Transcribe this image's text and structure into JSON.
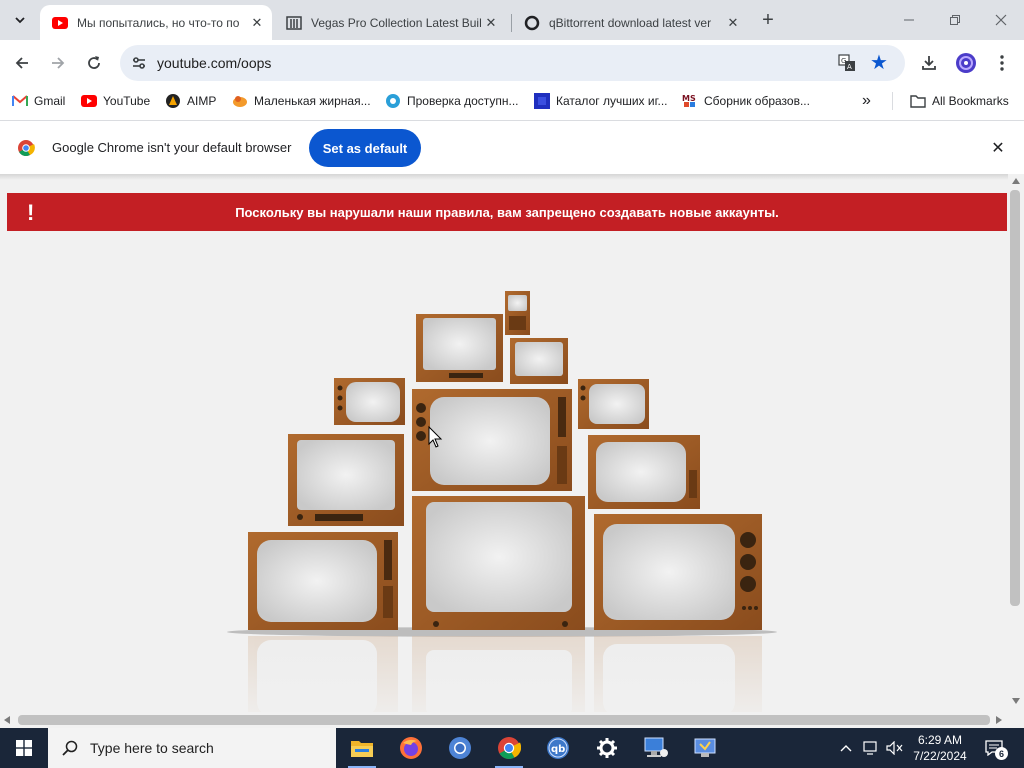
{
  "tabs": [
    {
      "title": "Мы попытались, но что-то по",
      "favicon": "youtube-icon",
      "active": true
    },
    {
      "title": "Vegas Pro Collection Latest Buil",
      "favicon": "building-icon",
      "active": false
    },
    {
      "title": "qBittorrent download latest ver",
      "favicon": "circle-o-icon",
      "active": false
    }
  ],
  "address_bar": {
    "url": "youtube.com/oops"
  },
  "bookmarks": [
    {
      "label": "Gmail",
      "icon": "gmail-icon"
    },
    {
      "label": "YouTube",
      "icon": "youtube-icon"
    },
    {
      "label": "AIMP",
      "icon": "aimp-icon"
    },
    {
      "label": "Маленькая жирная...",
      "icon": "orange-blob-icon"
    },
    {
      "label": "Проверка доступн...",
      "icon": "globe-gear-icon"
    },
    {
      "label": "Каталог лучших иг...",
      "icon": "square-blue-icon"
    },
    {
      "label": "Сборник образов...",
      "icon": "ms-icon"
    }
  ],
  "bookmarks_overflow": "»",
  "all_bookmarks": "All Bookmarks",
  "infobar": {
    "message": "Google Chrome isn't your default browser",
    "button": "Set as default"
  },
  "error_banner": {
    "text": "Поскольку вы нарушали наши правила, вам запрещено создавать новые аккаунты.",
    "icon": "!"
  },
  "colors": {
    "banner": "#c31f24",
    "accent": "#0b57d0",
    "wood": "#9c5a25"
  },
  "taskbar": {
    "search_placeholder": "Type here to search",
    "time": "6:29 AM",
    "date": "7/22/2024",
    "notification_count": "6",
    "apps": [
      "file-explorer-icon",
      "firefox-icon",
      "chromium-icon",
      "chrome-icon",
      "qbittorrent-icon",
      "settings-icon",
      "network-tool-icon",
      "remote-app-icon"
    ]
  }
}
